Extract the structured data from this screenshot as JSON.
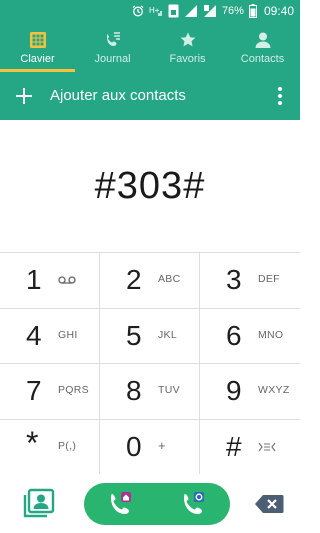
{
  "status_bar": {
    "battery": "76%",
    "time": "09:40",
    "icons": [
      "alarm-icon",
      "hplus-icon",
      "cellular-signal-icon",
      "sim-signal-icon",
      "battery-icon"
    ]
  },
  "tabs": [
    {
      "label": "Clavier",
      "icon": "keypad-icon",
      "active": true
    },
    {
      "label": "Journal",
      "icon": "call-log-icon",
      "active": false
    },
    {
      "label": "Favoris",
      "icon": "star-icon",
      "active": false
    },
    {
      "label": "Contacts",
      "icon": "person-icon",
      "active": false
    }
  ],
  "action": {
    "add_label": "Ajouter aux contacts",
    "add_icon": "plus-icon",
    "more_icon": "more-vert-icon"
  },
  "dialer": {
    "number": "#303#"
  },
  "keypad": [
    {
      "digit": "1",
      "sub": "",
      "sub_icon": "voicemail-icon"
    },
    {
      "digit": "2",
      "sub": "ABC"
    },
    {
      "digit": "3",
      "sub": "DEF"
    },
    {
      "digit": "4",
      "sub": "GHI"
    },
    {
      "digit": "5",
      "sub": "JKL"
    },
    {
      "digit": "6",
      "sub": "MNO"
    },
    {
      "digit": "7",
      "sub": "PQRS"
    },
    {
      "digit": "8",
      "sub": "TUV"
    },
    {
      "digit": "9",
      "sub": "WXYZ"
    },
    {
      "digit": "*",
      "sub": "P(,)"
    },
    {
      "digit": "0",
      "sub": "+"
    },
    {
      "digit": "#",
      "sub": "",
      "sub_icon": "wait-icon"
    }
  ],
  "bottom": {
    "contacts_icon": "contact-card-icon",
    "call_sim1_icon": "phone-sim-home-icon",
    "call_sim2_icon": "phone-sim-2-icon",
    "delete_icon": "backspace-icon"
  },
  "colors": {
    "primary": "#25a684",
    "accent": "#f6c23d",
    "call": "#29b46f"
  }
}
